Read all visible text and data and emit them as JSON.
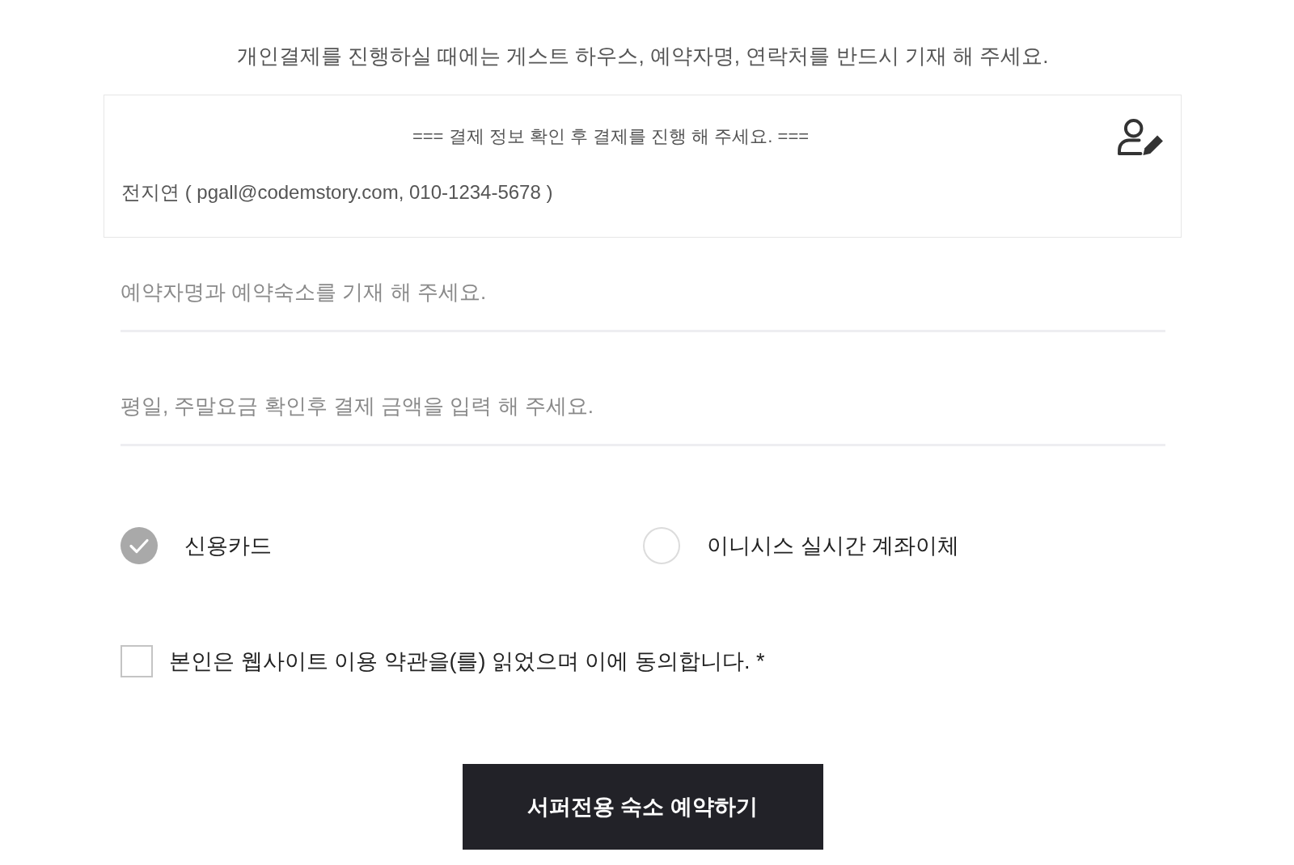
{
  "notice": "개인결제를 진행하실 때에는 게스트 하우스, 예약자명, 연락처를 반드시 기재 해 주세요.",
  "info_box": {
    "title": "=== 결제 정보 확인 후 결제를 진행 해 주세요. ===",
    "buyer": "전지연 ( pgall@codemstory.com, 010-1234-5678 )"
  },
  "fields": [
    {
      "placeholder": "예약자명과 예약숙소를 기재 해 주세요."
    },
    {
      "placeholder": "평일, 주말요금 확인후 결제 금액을 입력 해 주세요."
    }
  ],
  "payment_methods": [
    {
      "label": "신용카드",
      "selected": true
    },
    {
      "label": "이니시스 실시간 계좌이체",
      "selected": false
    }
  ],
  "agreement": {
    "label": "본인은 웹사이트 이용 약관을(를) 읽었으며 이에 동의합니다. *",
    "checked": false
  },
  "submit_button": "서퍼전용 숙소 예약하기"
}
